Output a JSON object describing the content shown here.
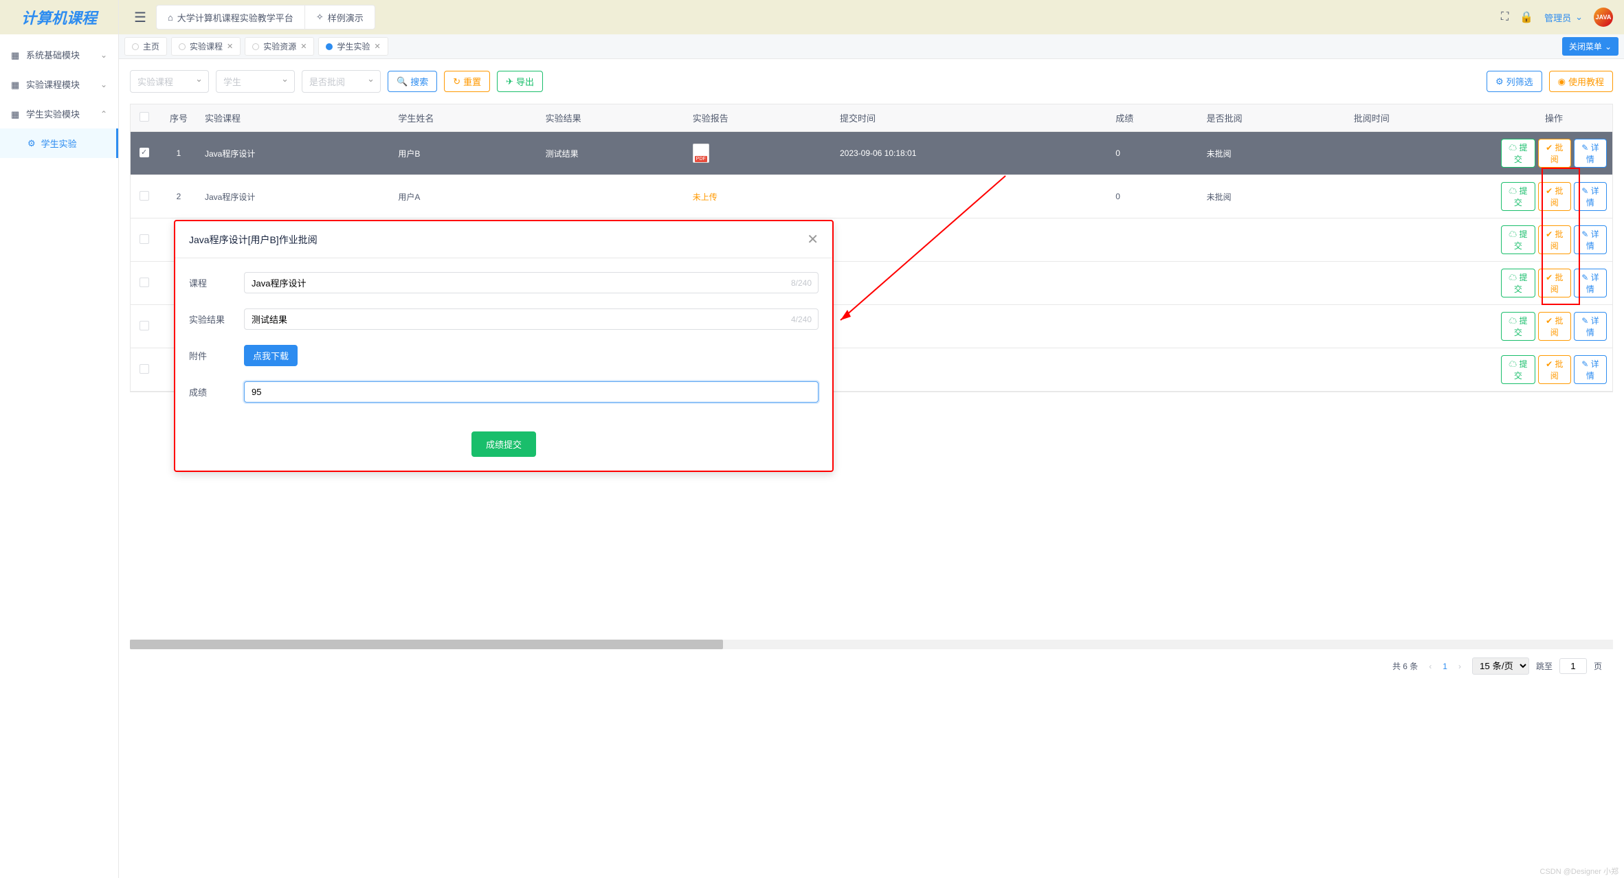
{
  "logo": "计算机课程",
  "sidebar": {
    "items": [
      {
        "label": "系统基础模块",
        "expanded": false
      },
      {
        "label": "实验课程模块",
        "expanded": false
      },
      {
        "label": "学生实验模块",
        "expanded": true
      }
    ],
    "submenu": {
      "label": "学生实验"
    }
  },
  "header": {
    "platform": "大学计算机课程实验教学平台",
    "demo": "样例演示",
    "user": "管理员",
    "avatar": "JAVA"
  },
  "tabs": {
    "items": [
      {
        "label": "主页",
        "closable": false,
        "active": false
      },
      {
        "label": "实验课程",
        "closable": true,
        "active": false
      },
      {
        "label": "实验资源",
        "closable": true,
        "active": false
      },
      {
        "label": "学生实验",
        "closable": true,
        "active": true
      }
    ],
    "close_menu": "关闭菜单"
  },
  "filters": {
    "course": "实验课程",
    "student": "学生",
    "reviewed": "是否批阅",
    "search": "搜索",
    "reset": "重置",
    "export": "导出",
    "col_filter": "列筛选",
    "tutorial": "使用教程"
  },
  "table": {
    "headers": [
      "",
      "序号",
      "实验课程",
      "学生姓名",
      "实验结果",
      "实验报告",
      "提交时间",
      "成绩",
      "是否批阅",
      "批阅时间",
      "操作"
    ],
    "rows": [
      {
        "idx": "1",
        "course": "Java程序设计",
        "student": "用户B",
        "result": "测试结果",
        "report": "pdf",
        "submit_time": "2023-09-06 10:18:01",
        "score": "0",
        "reviewed": "未批阅",
        "review_time": "",
        "selected": true
      },
      {
        "idx": "2",
        "course": "Java程序设计",
        "student": "用户A",
        "result": "",
        "report": "not_uploaded",
        "submit_time": "",
        "score": "0",
        "reviewed": "未批阅",
        "review_time": "",
        "selected": false
      },
      {
        "idx": "",
        "course": "",
        "student": "",
        "result": "",
        "report": "",
        "submit_time": "",
        "score": "",
        "reviewed": "",
        "review_time": "",
        "selected": false
      },
      {
        "idx": "",
        "course": "",
        "student": "",
        "result": "",
        "report": "",
        "submit_time": "",
        "score": "",
        "reviewed": "",
        "review_time": "",
        "selected": false
      },
      {
        "idx": "",
        "course": "",
        "student": "",
        "result": "",
        "report": "",
        "submit_time": "",
        "score": "",
        "reviewed": "",
        "review_time": "",
        "selected": false
      },
      {
        "idx": "",
        "course": "",
        "student": "",
        "result": "",
        "report": "",
        "submit_time": "",
        "score": "",
        "reviewed": "",
        "review_time": "",
        "selected": false
      }
    ],
    "not_uploaded": "未上传",
    "actions": {
      "submit": "提交",
      "review": "批阅",
      "detail": "详情"
    }
  },
  "modal": {
    "title": "Java程序设计[用户B]作业批阅",
    "course_label": "课程",
    "course_value": "Java程序设计",
    "course_count": "8/240",
    "result_label": "实验结果",
    "result_value": "测试结果",
    "result_count": "4/240",
    "attach_label": "附件",
    "download": "点我下载",
    "score_label": "成绩",
    "score_value": "95",
    "submit": "成绩提交"
  },
  "pagination": {
    "total": "共 6 条",
    "per_page_value": "15 条/页",
    "jump_label": "跳至",
    "page": "1",
    "page_suffix": "页"
  },
  "watermark": "CSDN @Designer 小郑"
}
